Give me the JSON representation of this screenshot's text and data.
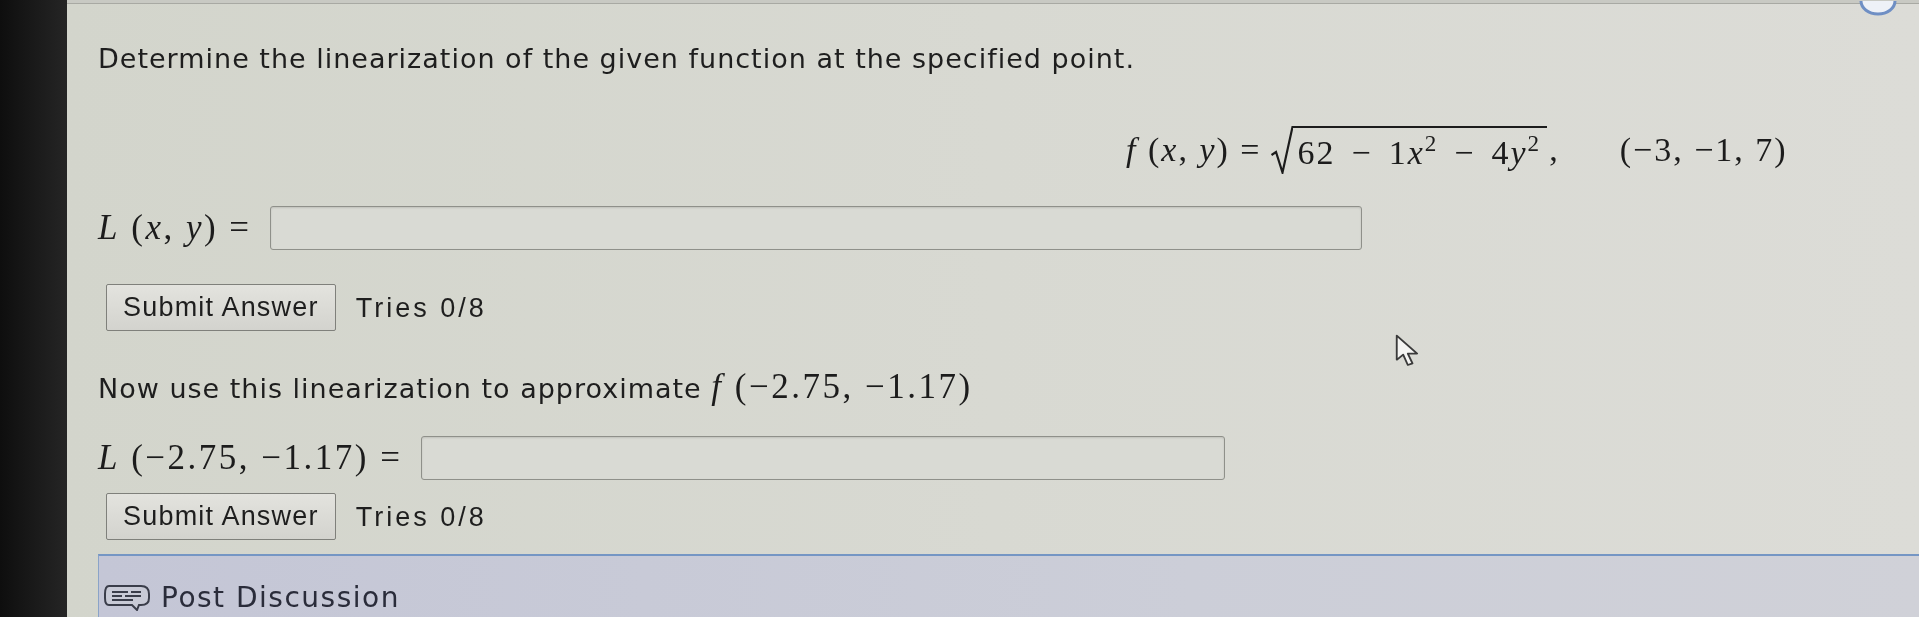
{
  "question": {
    "prompt": "Determine the linearization of the given function at the specified point.",
    "formula": {
      "lhs": "*f* (*x*, *y*) =",
      "radicand": [
        {
          "coefficient": "62"
        },
        {
          "operator": "−"
        },
        {
          "coefficient": "1",
          "variable": "x",
          "power": "2"
        },
        {
          "operator": "−"
        },
        {
          "coefficient": "4",
          "variable": "y",
          "power": "2"
        }
      ],
      "separator": ",",
      "point": "(−3, −1, 7)"
    }
  },
  "parts": [
    {
      "label": "*L* (*x*, *y*) =",
      "button": "Submit Answer",
      "tries": "Tries 0/8"
    },
    {
      "intro": "Now use this linearization to approximate",
      "intro_math": "*f* (−2.75, −1.17)",
      "label": "*L* (−2.75, −1.17) =",
      "button": "Submit Answer",
      "tries": "Tries 0/8"
    }
  ],
  "discussion": {
    "label": "Post Discussion"
  }
}
